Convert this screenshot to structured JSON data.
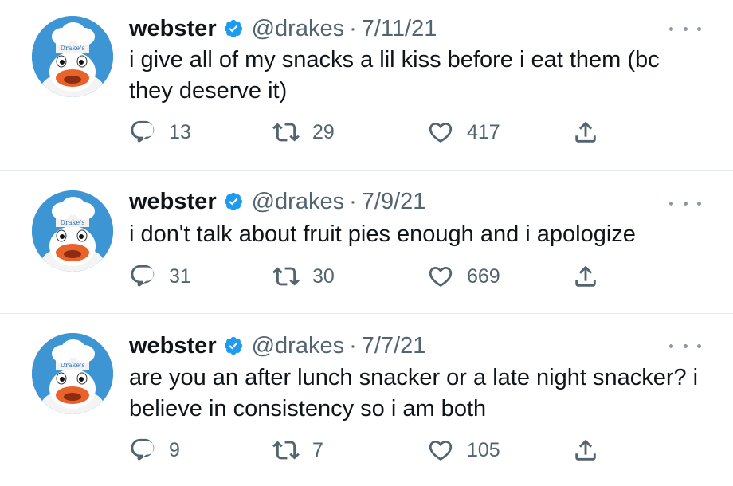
{
  "tweets": [
    {
      "name": "webster",
      "handle": "@drakes",
      "separator": "·",
      "date": "7/11/21",
      "text": "i give all of my snacks a lil kiss before i eat them (bc they deserve it)",
      "replies": "13",
      "retweets": "29",
      "likes": "417"
    },
    {
      "name": "webster",
      "handle": "@drakes",
      "separator": "·",
      "date": "7/9/21",
      "text": "i don't talk about fruit pies enough and i apologize",
      "replies": "31",
      "retweets": "30",
      "likes": "669"
    },
    {
      "name": "webster",
      "handle": "@drakes",
      "separator": "·",
      "date": "7/7/21",
      "text": "are you an after lunch snacker or a late night snacker? i believe in consistency so i am both",
      "replies": "9",
      "retweets": "7",
      "likes": "105"
    }
  ],
  "avatar_logo_text": "Drake's",
  "colors": {
    "verified_badge": "#1d9bf0",
    "secondary_text": "#536471",
    "avatar_background": "#3e95d4",
    "divider": "#e6ecf0"
  },
  "icons": {
    "verified": "verified-badge-icon",
    "more": "more-dots-icon",
    "reply": "reply-icon",
    "retweet": "retweet-icon",
    "like": "heart-icon",
    "share": "share-icon"
  }
}
